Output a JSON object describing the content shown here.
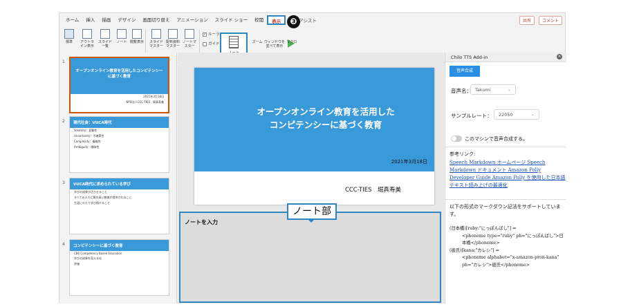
{
  "ribbon": {
    "tabs": [
      "ホーム",
      "挿入",
      "描画",
      "デザイン",
      "画面切り替え",
      "アニメーション",
      "スライド ショー",
      "校閲",
      "表示"
    ],
    "active_tab": "表示",
    "assist": "操作アシスト",
    "share": "共有",
    "comment": "コメント",
    "step_badge": "❸",
    "buttons": {
      "standard": "標準",
      "outline": "アウトライン表示",
      "slide_sorter": "スライド一覧",
      "notes_page": "ノート",
      "reading": "閲覧表示",
      "slide_master": "スライドマスター",
      "handout_master": "配布資料マスター",
      "notes_master": "ノートマスター",
      "ruler": "ルーラー",
      "guides": "ガイド",
      "notes": "ノート",
      "zoom": "ズーム",
      "new_window": "ウィンドウを並べて表示",
      "macro": "マクロ"
    }
  },
  "thumbnails": [
    {
      "num": "1",
      "title": "オープンオンライン教育を活用したコンピテンシーに基づく教育",
      "lines": [
        "2021年3月18日",
        "NPO法人CCC-TIES　堀真寿美"
      ]
    },
    {
      "num": "2",
      "title": "現代社会：VUCA時代",
      "lines": [
        "Volatility：変動性",
        "Uncertainty：不確実性",
        "Complexity：複雑性",
        "Ambiguity：曖昧性"
      ]
    },
    {
      "num": "3",
      "title": "VUCA時代に求められている学び",
      "lines": [
        "学びの成果が活かせること",
        "すべての人々に質の高い教育が提供されること",
        "生涯にわたり学び続けること"
      ]
    },
    {
      "num": "4",
      "title": "コンピテンシーに基づく教育",
      "lines": [
        "CBE:Competency Based Education",
        "学びの成果を見える化",
        "評価"
      ]
    }
  ],
  "slide": {
    "title_line1": "オープンオンライン教育を活用した",
    "title_line2": "コンピテンシーに基づく教育",
    "date": "2021年3月18日",
    "org": "CCC-TIES　堀真寿美"
  },
  "notes": {
    "placeholder": "ノートを入力",
    "callout": "ノート部"
  },
  "addin": {
    "title": "Chilo TTS Add-in",
    "synth_button": "音声合成",
    "voice_label": "音声名：",
    "voice_value": "Takumi",
    "rate_label": "サンプルレート：",
    "rate_value": "22050",
    "local_label": "このマシンで音声合成する。",
    "ref_label": "参考リンク:",
    "links": "Speech Markdown ホームページ Speech Markdown ドキュメント Amazon Polly Developer Guide Amazon Polly を使用した日本語テキスト読み上げの最適化",
    "desc": "以下の形式のマークダウン記法をサポートしています。",
    "code1": "(日本橋)[ruby:\"にっぽんばし\"] ⇒",
    "code2": "<phoneme type=\"ruby\" ph=\"にっぽんばし\">日本橋</phoneme>",
    "code3": "(彼氏)[kana:\"カレシ\"] ⇒",
    "code4": "<phoneme alphabet=\"x-amazon-pron-kana\" ph=\"カレシ\">彼氏</phoneme>"
  }
}
